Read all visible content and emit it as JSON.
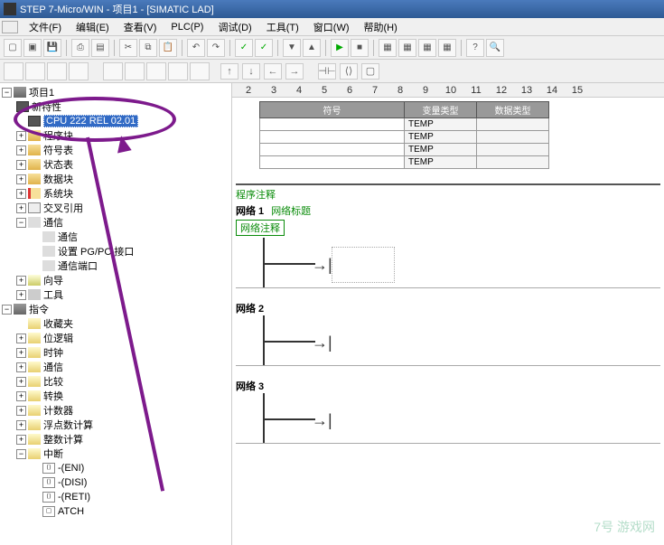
{
  "title": "STEP 7-Micro/WIN - 项目1 - [SIMATIC LAD]",
  "menu": {
    "icon": "app",
    "items": [
      "文件(F)",
      "编辑(E)",
      "查看(V)",
      "PLC(P)",
      "调试(D)",
      "工具(T)",
      "窗口(W)",
      "帮助(H)"
    ]
  },
  "ruler": [
    "2",
    "3",
    "4",
    "5",
    "6",
    "7",
    "8",
    "9",
    "10",
    "11",
    "12",
    "13",
    "14",
    "15"
  ],
  "tree": {
    "root": "项目1",
    "cpu_new": "新特性",
    "cpu_selected": "CPU 222 REL 02.01",
    "program": "程序块",
    "items": [
      "符号表",
      "状态表",
      "数据块",
      "系统块",
      "交叉引用"
    ],
    "comm": "通信",
    "comm_sub": [
      "通信",
      "设置 PG/PC 接口",
      "通信端口"
    ],
    "wizard": "向导",
    "tools": "工具",
    "instructions": "指令",
    "fav": "收藏夹",
    "instr_items": [
      "位逻辑",
      "时钟",
      "通信",
      "比较",
      "转换",
      "计数器",
      "浮点数计算",
      "整数计算"
    ],
    "interrupt": "中断",
    "int_items": [
      "-(ENI)",
      "-(DISI)",
      "-(RETI)",
      "ATCH"
    ]
  },
  "var_table": {
    "headers": [
      "符号",
      "变量类型",
      "数据类型"
    ],
    "rows": [
      {
        "sym": "",
        "type": "TEMP",
        "dtype": ""
      },
      {
        "sym": "",
        "type": "TEMP",
        "dtype": ""
      },
      {
        "sym": "",
        "type": "TEMP",
        "dtype": ""
      },
      {
        "sym": "",
        "type": "TEMP",
        "dtype": ""
      }
    ]
  },
  "lad": {
    "prog_comment": "程序注释",
    "nets": [
      {
        "name": "网络 1",
        "title": "网络标题",
        "comment": "网络注释",
        "box": true
      },
      {
        "name": "网络 2",
        "title": "",
        "comment": "",
        "box": false
      },
      {
        "name": "网络 3",
        "title": "",
        "comment": "",
        "box": false
      }
    ]
  },
  "watermark": "7号 游戏网"
}
